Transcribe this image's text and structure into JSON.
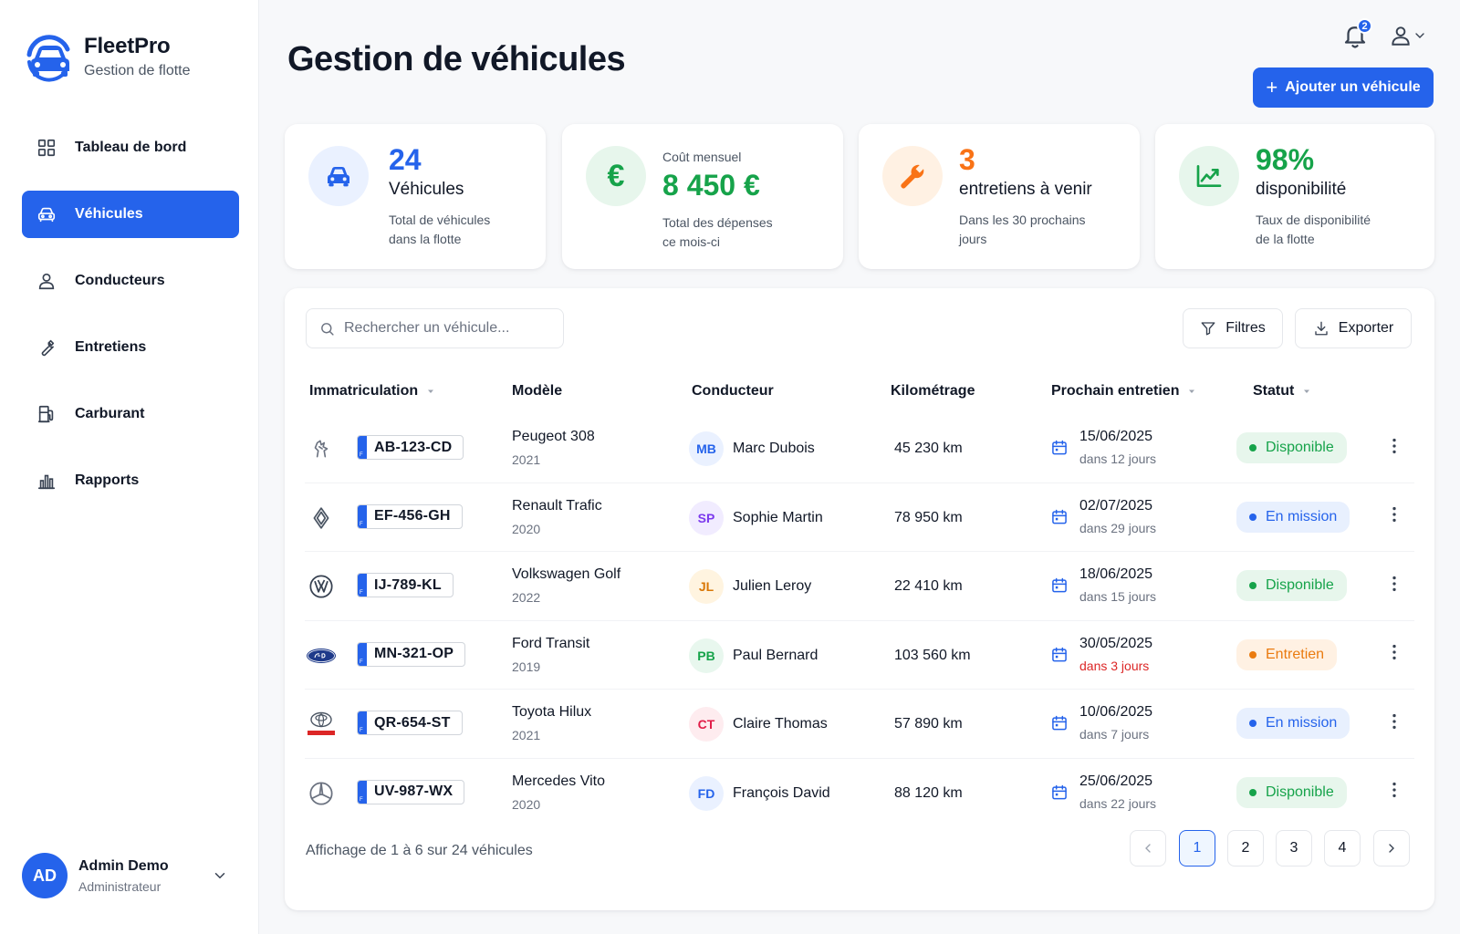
{
  "app": {
    "name": "FleetPro",
    "subtitle": "Gestion de flotte"
  },
  "nav": [
    {
      "label": "Tableau de bord",
      "icon": "grid-icon",
      "active": false
    },
    {
      "label": "Véhicules",
      "icon": "car-icon",
      "active": true
    },
    {
      "label": "Conducteurs",
      "icon": "user-icon",
      "active": false
    },
    {
      "label": "Entretiens",
      "icon": "wrench-icon",
      "active": false
    },
    {
      "label": "Carburant",
      "icon": "fuel-pump-icon",
      "active": false
    },
    {
      "label": "Rapports",
      "icon": "bar-chart-icon",
      "active": false
    }
  ],
  "user": {
    "initials": "AD",
    "name": "Admin Demo",
    "role": "Administrateur"
  },
  "header": {
    "title": "Gestion de véhicules",
    "notifications_count": "2",
    "add_button": "Ajouter un véhicule"
  },
  "stats": [
    {
      "value": "24",
      "label": "Véhicules",
      "desc": "Total de véhicules dans la flotte",
      "color": "#2563eb",
      "icon": "car-icon"
    },
    {
      "small": "Coût mensuel",
      "value": "8 450 €",
      "desc": "Total des dépenses ce mois-ci",
      "color": "#16a34a",
      "icon": "euro-icon"
    },
    {
      "value": "3",
      "label": "entretiens à venir",
      "desc": "Dans les 30 prochains jours",
      "color": "#f97316",
      "icon": "wrench-icon"
    },
    {
      "value": "98%",
      "label": "disponibilité",
      "desc": "Taux de disponibilité de la flotte",
      "color": "#16a34a",
      "icon": "trend-up-icon"
    }
  ],
  "toolbar": {
    "search_placeholder": "Rechercher un véhicule...",
    "filters_label": "Filtres",
    "export_label": "Exporter"
  },
  "columns": [
    "Immatriculation",
    "Modèle",
    "Conducteur",
    "Kilométrage",
    "Prochain entretien",
    "Statut"
  ],
  "rows": [
    {
      "brand": "peugeot-logo-icon",
      "plate": "AB-123-CD",
      "model": "Peugeot 308",
      "year": "2021",
      "initials": "MB",
      "driver": "Marc Dubois",
      "avatar_bg": "#eaf1ff",
      "avatar_fg": "#2563eb",
      "km": "45 230 km",
      "date": "15/06/2025",
      "rel": "dans 12 jours",
      "urgent": false,
      "status": "Disponible",
      "status_kind": "ok"
    },
    {
      "brand": "renault-logo-icon",
      "plate": "EF-456-GH",
      "model": "Renault Trafic",
      "year": "2020",
      "initials": "SP",
      "driver": "Sophie Martin",
      "avatar_bg": "#f1ecff",
      "avatar_fg": "#7c3aed",
      "km": "78 950 km",
      "date": "02/07/2025",
      "rel": "dans 29 jours",
      "urgent": false,
      "status": "En mission",
      "status_kind": "mission"
    },
    {
      "brand": "volkswagen-logo-icon",
      "plate": "IJ-789-KL",
      "model": "Volkswagen Golf",
      "year": "2022",
      "initials": "JL",
      "driver": "Julien Leroy",
      "avatar_bg": "#fff4e0",
      "avatar_fg": "#d97706",
      "km": "22 410 km",
      "date": "18/06/2025",
      "rel": "dans 15 jours",
      "urgent": false,
      "status": "Disponible",
      "status_kind": "ok"
    },
    {
      "brand": "ford-logo-icon",
      "plate": "MN-321-OP",
      "model": "Ford Transit",
      "year": "2019",
      "initials": "PB",
      "driver": "Paul Bernard",
      "avatar_bg": "#e8f7ee",
      "avatar_fg": "#16a34a",
      "km": "103 560 km",
      "date": "30/05/2025",
      "rel": "dans 3 jours",
      "urgent": true,
      "status": "Entretien",
      "status_kind": "maint"
    },
    {
      "brand": "toyota-logo-icon",
      "plate": "QR-654-ST",
      "model": "Toyota Hilux",
      "year": "2021",
      "initials": "CT",
      "driver": "Claire Thomas",
      "avatar_bg": "#feecef",
      "avatar_fg": "#e11d48",
      "km": "57 890 km",
      "date": "10/06/2025",
      "rel": "dans 7 jours",
      "urgent": false,
      "status": "En mission",
      "status_kind": "mission"
    },
    {
      "brand": "mercedes-logo-icon",
      "plate": "UV-987-WX",
      "model": "Mercedes Vito",
      "year": "2020",
      "initials": "FD",
      "driver": "François David",
      "avatar_bg": "#eaf1ff",
      "avatar_fg": "#2563eb",
      "km": "88 120 km",
      "date": "25/06/2025",
      "rel": "dans 22 jours",
      "urgent": false,
      "status": "Disponible",
      "status_kind": "ok"
    }
  ],
  "status_colors": {
    "ok": {
      "bg": "#e7f6ec",
      "fg": "#16a34a"
    },
    "mission": {
      "bg": "#e8f0fe",
      "fg": "#2563eb"
    },
    "maint": {
      "bg": "#fff1e3",
      "fg": "#ea7b10"
    }
  },
  "footer": {
    "info": "Affichage de 1 à 6 sur 24 véhicules",
    "pages": [
      "1",
      "2",
      "3",
      "4"
    ],
    "current_page": "1"
  }
}
